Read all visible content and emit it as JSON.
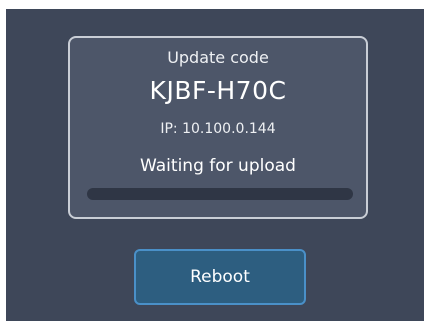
{
  "card": {
    "title": "Update code",
    "code": "KJBF-H70C",
    "ip": "IP: 10.100.0.144",
    "status": "Waiting for upload",
    "progress_fraction": 0
  },
  "actions": {
    "reboot_label": "Reboot"
  },
  "colors": {
    "background": "#3e4759",
    "card_border": "#c9ced6",
    "progress_track": "#2f3645",
    "button_fill": "#2d5e80",
    "button_border": "#4a90c8"
  }
}
